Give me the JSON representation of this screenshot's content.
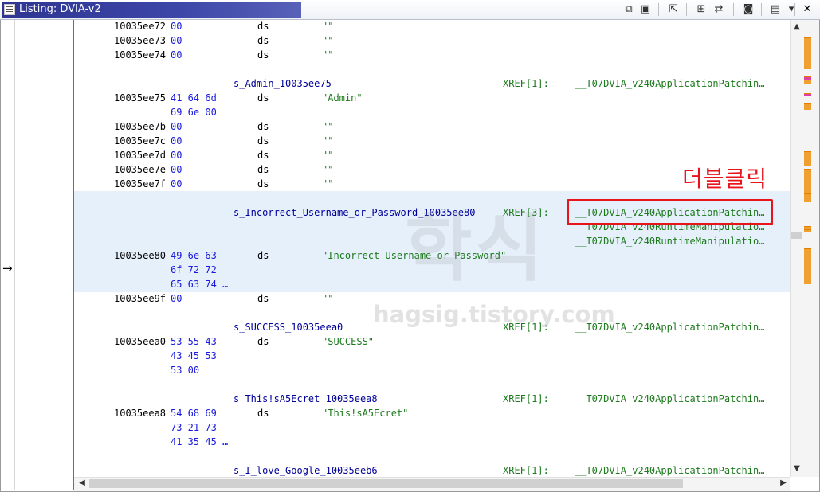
{
  "window": {
    "title": "Listing:  DVIA-v2"
  },
  "toolbar": {
    "buttons": [
      {
        "name": "copy-icon",
        "glyph": "⧉"
      },
      {
        "name": "paste-icon",
        "glyph": "▣"
      },
      {
        "name": "cursor-select-icon",
        "glyph": "⇱"
      },
      {
        "name": "field-options-icon",
        "glyph": "⊞"
      },
      {
        "name": "diff-view-icon",
        "glyph": "⇄"
      },
      {
        "name": "snapshot-icon",
        "glyph": "◙"
      },
      {
        "name": "display-options-icon",
        "glyph": "▤"
      },
      {
        "name": "dropdown-arrow-icon",
        "glyph": "▾"
      },
      {
        "name": "close-icon",
        "glyph": "✕"
      }
    ]
  },
  "gutter": {
    "cursor_marker": "→"
  },
  "listing": {
    "rows": [
      {
        "addr": "10035ee72",
        "bytes": "00",
        "mnem": "ds",
        "oper": "\"\""
      },
      {
        "addr": "10035ee73",
        "bytes": "00",
        "mnem": "ds",
        "oper": "\"\""
      },
      {
        "addr": "10035ee74",
        "bytes": "00",
        "mnem": "ds",
        "oper": "\"\""
      },
      {
        "label": "s_Admin_10035ee75",
        "xref": "XREF[1]:",
        "xref_target": "__T07DVIA_v240ApplicationPatchin…"
      },
      {
        "addr": "10035ee75",
        "bytes": "41 64 6d",
        "mnem": "ds",
        "oper": "\"Admin\""
      },
      {
        "bytes": "69 6e 00"
      },
      {
        "addr": "10035ee7b",
        "bytes": "00",
        "mnem": "ds",
        "oper": "\"\""
      },
      {
        "addr": "10035ee7c",
        "bytes": "00",
        "mnem": "ds",
        "oper": "\"\""
      },
      {
        "addr": "10035ee7d",
        "bytes": "00",
        "mnem": "ds",
        "oper": "\"\""
      },
      {
        "addr": "10035ee7e",
        "bytes": "00",
        "mnem": "ds",
        "oper": "\"\""
      },
      {
        "addr": "10035ee7f",
        "bytes": "00",
        "mnem": "ds",
        "oper": "\"\""
      },
      {
        "label": "s_Incorrect_Username_or_Password_10035ee80",
        "xref": "XREF[3]:",
        "xref_target": "__T07DVIA_v240ApplicationPatchin…"
      },
      {
        "xref_target": "__T07DVIA_v240RuntimeManipulatio…"
      },
      {
        "xref_target": "__T07DVIA_v240RuntimeManipulatio…"
      },
      {
        "addr": "10035ee80",
        "bytes": "49 6e 63",
        "mnem": "ds",
        "oper": "\"Incorrect Username or Password\""
      },
      {
        "bytes": "6f 72 72"
      },
      {
        "bytes": "65 63 74 …"
      },
      {
        "addr": "10035ee9f",
        "bytes": "00",
        "mnem": "ds",
        "oper": "\"\""
      },
      {
        "label": "s_SUCCESS_10035eea0",
        "xref": "XREF[1]:",
        "xref_target": "__T07DVIA_v240ApplicationPatchin…"
      },
      {
        "addr": "10035eea0",
        "bytes": "53 55 43",
        "mnem": "ds",
        "oper": "\"SUCCESS\""
      },
      {
        "bytes": "43 45 53"
      },
      {
        "bytes": "53 00"
      },
      {
        "label": "s_This!sA5Ecret_10035eea8",
        "xref": "XREF[1]:",
        "xref_target": "__T07DVIA_v240ApplicationPatchin…"
      },
      {
        "addr": "10035eea8",
        "bytes": "54 68 69",
        "mnem": "ds",
        "oper": "\"This!sA5Ecret\""
      },
      {
        "bytes": "73 21 73"
      },
      {
        "bytes": "41 35 45 …"
      },
      {
        "label": "s_I_love_Google_10035eeb6",
        "xref": "XREF[1]:",
        "xref_target": "__T07DVIA_v240ApplicationPatchin…"
      }
    ]
  },
  "annotation": {
    "text": "더블클릭"
  },
  "watermark": {
    "big": "학식",
    "small": "hagsig.tistory.com"
  },
  "scrollbars": {
    "up": "▲",
    "down": "▼",
    "left": "◀",
    "right": "▶"
  },
  "colors": {
    "title_bar": "#2e3592",
    "highlight": "#e6f0fb",
    "annotation": "#e8141c",
    "xref": "#1c7a1c",
    "bytes": "#1a1ae0"
  }
}
